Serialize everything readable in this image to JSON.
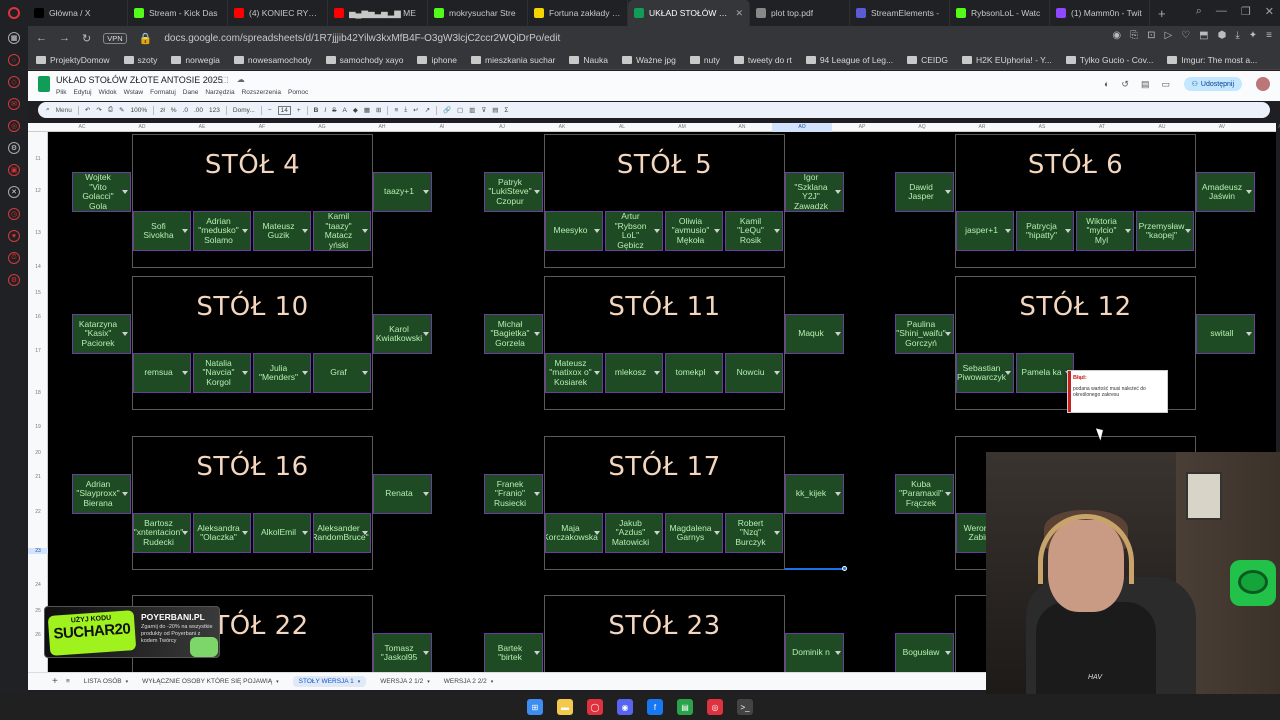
{
  "browser": {
    "tabs": [
      {
        "label": "Główna / X",
        "color": "#000000",
        "icon": "x-icon"
      },
      {
        "label": "Stream - Kick Das",
        "color": "#53fc18",
        "icon": "kick-icon"
      },
      {
        "label": "(4) KONIEC RYBSO",
        "color": "#ff0000",
        "icon": "youtube-icon"
      },
      {
        "label": "▅▄▆▅▃▅▂▆ ME",
        "color": "#ff0000",
        "icon": "youtube-icon"
      },
      {
        "label": "mokrysuchar Stre",
        "color": "#53fc18",
        "icon": "kick-icon"
      },
      {
        "label": "Fortuna zakłady bu",
        "color": "#f5d400",
        "icon": "fortuna-icon"
      },
      {
        "label": "UKŁAD STOŁÓW ZŁOTE A",
        "color": "#0f9d58",
        "icon": "sheets-icon"
      },
      {
        "label": "plot top.pdf",
        "color": "#888888",
        "icon": "pdf-icon"
      },
      {
        "label": "StreamElements -",
        "color": "#5b5bd6",
        "icon": "streamelements-icon"
      },
      {
        "label": "RybsonLoL - Watc",
        "color": "#53fc18",
        "icon": "kick-icon"
      },
      {
        "label": "(1) Mamm0n - Twit",
        "color": "#9146ff",
        "icon": "twitch-icon"
      }
    ],
    "active_tab": 6,
    "vpn_label": "VPN",
    "url": "docs.google.com/spreadsheets/d/1R7jjjib42Yilw3kxMfB4F-O3gW3lcjC2ccr2WQiDrPo/edit",
    "bookmarks": [
      "ProjektyDomow",
      "szoty",
      "norwegia",
      "nowesamochody",
      "samochody xayo",
      "iphone",
      "mieszkania suchar",
      "Nauka",
      "Ważne jpg",
      "nuty",
      "tweety do rt",
      "94 League of Leg...",
      "CEIDG",
      "H2K EUphoria! - Y...",
      "Tylko Gucio - Cov...",
      "Imgur: The most a..."
    ]
  },
  "sheets": {
    "title": "UKŁAD STOŁÓW ZŁOTE ANTOSIE 2025",
    "menus": [
      "Plik",
      "Edytuj",
      "Widok",
      "Wstaw",
      "Formatuj",
      "Dane",
      "Narzędzia",
      "Rozszerzenia",
      "Pomoc"
    ],
    "share_label": "Udostępnij",
    "toolbar": {
      "search": "Menu",
      "zoom": "100%",
      "format": "123",
      "font": "Domy...",
      "font_size": "14"
    },
    "columns": [
      "AC",
      "AD",
      "AE",
      "AF",
      "AG",
      "AH",
      "AI",
      "AJ",
      "AK",
      "AL",
      "AM",
      "AN",
      "AO",
      "AP",
      "AQ",
      "AR",
      "AS",
      "AT",
      "AU",
      "AV",
      "AW"
    ],
    "selected_column": "AO",
    "rows": [
      "11",
      "12",
      "13",
      "14",
      "15",
      "16",
      "17",
      "18",
      "19",
      "20",
      "21",
      "22",
      "23",
      "24",
      "25",
      "26"
    ],
    "selected_row": "23",
    "sheet_tabs": [
      "LISTA OSÓB",
      "WYŁĄCZNIE OSOBY KTÓRE SIĘ POJAWIĄ",
      "STOŁY WERSJA 1",
      "WERSJA 2 1/2",
      "WERSJA 2 2/2"
    ],
    "active_sheet": 2,
    "error_tooltip": {
      "title": "Błąd:",
      "message": "podana wartość musi należeć do określonego zakresu"
    }
  },
  "tables": [
    {
      "title": "STÓŁ 4",
      "left": "Wojtek \"Vito Golacci\" Gola",
      "right": "taazy+1",
      "bottom": [
        "Sofi Sivokha",
        "Adrian \"medusko\" Solamo",
        "Mateusz Guzik",
        "Kamil \"taazy\" Matacz yński"
      ]
    },
    {
      "title": "STÓŁ 5",
      "left": "Patryk \"LukiSteve\" Czopur",
      "right": "Igor \"Szklana Y2J\" Zawadzk",
      "bottom": [
        "Meesyko",
        "Artur \"Rybson LoL\" Gębicz",
        "Oliwia \"avmusio\" Mękoła",
        "Kamil \"LeQu\" Rosik"
      ]
    },
    {
      "title": "STÓŁ 6",
      "left": "Dawid Jasper",
      "right": "Amadeusz Jaświn",
      "bottom": [
        "jasper+1",
        "Patrycja \"hipatty\"",
        "Wiktoria \"mylcio\" Myl",
        "Przemysław \"kaopej\""
      ]
    },
    {
      "title": "STÓŁ 10",
      "left": "Katarzyna \"Kasix\" Paciorek",
      "right": "Karol Kwiatkowski",
      "bottom": [
        "remsua",
        "Natalia \"Navcia\" Korgol",
        "Julia \"Menders\"",
        "Graf"
      ]
    },
    {
      "title": "STÓŁ 11",
      "left": "Michał \"Bagietka\" Gorzela",
      "right": "Maquk",
      "bottom": [
        "Mateusz \"matixox o\" Kosiarek",
        "mlekosz",
        "tomekpl",
        "Nowciu"
      ]
    },
    {
      "title": "STÓŁ 12",
      "left": "Paulina \"Shini_waifu\" Gorczyń",
      "right": "switall",
      "bottom": [
        "Sebastian Piwowarczyk",
        "Pamela ka",
        "",
        ""
      ]
    },
    {
      "title": "STÓŁ 16",
      "left": "Adrian \"Slayproxx\" Bierana",
      "right": "Renata",
      "bottom": [
        "Bartosz \"xntentacion\" Rudecki",
        "Aleksandra \"Olaczka\"",
        "AlkolEmil",
        "Aleksander \"RandomBruce\""
      ]
    },
    {
      "title": "STÓŁ 17",
      "left": "Franek \"Franio\" Rusiecki",
      "right": "kk_kijek",
      "bottom": [
        "Maja Korczakowska",
        "Jakub \"Azdus\" Matowicki",
        "Magdalena Garnys",
        "Robert \"Nzq\" Burczyk"
      ]
    },
    {
      "title": "",
      "left": "Kuba \"Paramaxil\" Frączek",
      "right": "",
      "bottom": [
        "Weronika Zabina",
        "",
        "",
        ""
      ]
    },
    {
      "title": "STÓŁ 22",
      "left": "",
      "right": "Tomasz \"Jaskol95",
      "bottom": []
    },
    {
      "title": "STÓŁ 23",
      "left": "Bartek \"birtek",
      "right": "Dominik n",
      "bottom": []
    },
    {
      "title": "",
      "left": "Bogusław",
      "right": "",
      "bottom": []
    }
  ],
  "promo": {
    "code_prefix": "UŻYJ KODU",
    "code": "SUCHAR20",
    "brand": "POYERBANI.PL",
    "text": "Zgarnij do -20% na wszystkie produkty od Poyerbani z kodem Twórcy"
  },
  "webcam": {
    "chair_brand": "HAV"
  },
  "taskbar_icons": [
    "windows-icon",
    "explorer-icon",
    "opera-icon",
    "discord-icon",
    "facebook-icon",
    "notes-icon",
    "chrome-icon",
    "terminal-icon"
  ],
  "colors": {
    "seat_bg": "#1e4a24",
    "seat_border": "#6a3da0",
    "seat_text": "#b4f0b0",
    "table_title": "#f4d6bf",
    "grid_bg": "#000000"
  }
}
